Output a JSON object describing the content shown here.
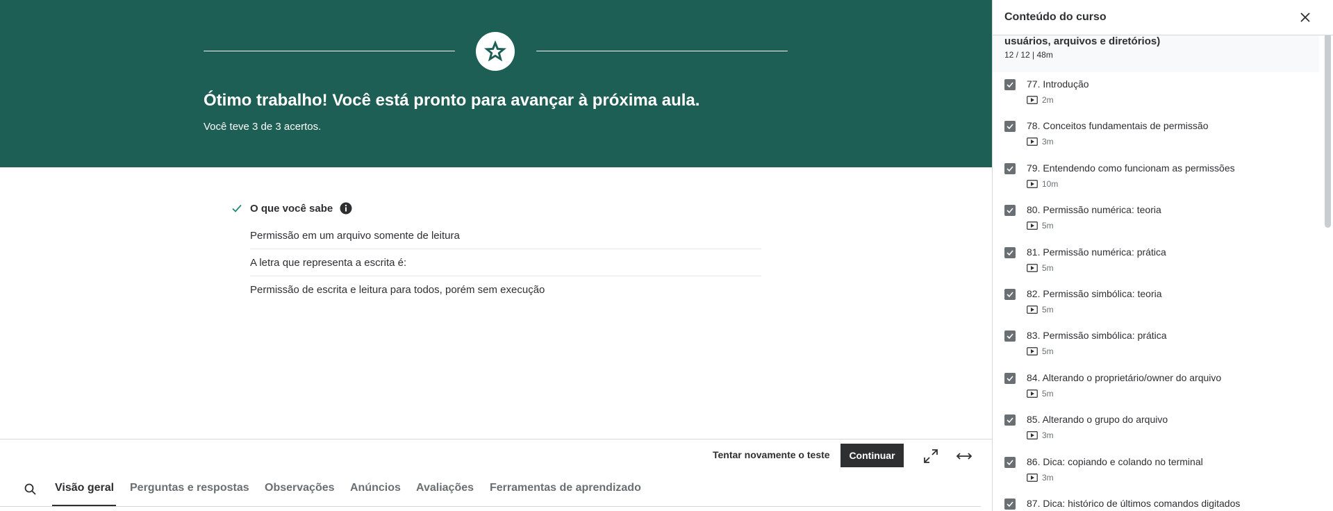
{
  "banner": {
    "title": "Ótimo trabalho! Você está pronto para avançar à próxima aula.",
    "subtitle": "Você teve 3 de 3 acertos.",
    "icon": "star-icon",
    "color": "#1e5f55"
  },
  "known": {
    "label": "O que você sabe",
    "items": [
      "Permissão em um arquivo somente de leitura",
      "A letra que representa a escrita é:",
      "Permissão de escrita e leitura para todos, porém sem execução"
    ]
  },
  "actions": {
    "retry_label": "Tentar novamente o teste",
    "continue_label": "Continuar"
  },
  "tabs": [
    {
      "label": "Visão geral",
      "active": true
    },
    {
      "label": "Perguntas e respostas",
      "active": false
    },
    {
      "label": "Observações",
      "active": false
    },
    {
      "label": "Anúncios",
      "active": false
    },
    {
      "label": "Avaliações",
      "active": false
    },
    {
      "label": "Ferramentas de aprendizado",
      "active": false
    }
  ],
  "sidebar": {
    "title": "Conteúdo do curso",
    "section": {
      "title": "usuários, arquivos e diretórios)",
      "meta": "12 / 12 | 48m"
    },
    "lessons": [
      {
        "title": "77. Introdução",
        "duration": "2m",
        "completed": true
      },
      {
        "title": "78. Conceitos fundamentais de permissão",
        "duration": "3m",
        "completed": true
      },
      {
        "title": "79. Entendendo como funcionam as permissões",
        "duration": "10m",
        "completed": true
      },
      {
        "title": "80. Permissão numérica: teoria",
        "duration": "5m",
        "completed": true
      },
      {
        "title": "81. Permissão numérica: prática",
        "duration": "5m",
        "completed": true
      },
      {
        "title": "82. Permissão simbólica: teoria",
        "duration": "5m",
        "completed": true
      },
      {
        "title": "83. Permissão simbólica: prática",
        "duration": "5m",
        "completed": true
      },
      {
        "title": "84. Alterando o proprietário/owner do arquivo",
        "duration": "5m",
        "completed": true
      },
      {
        "title": "85. Alterando o grupo do arquivo",
        "duration": "3m",
        "completed": true
      },
      {
        "title": "86. Dica: copiando e colando no terminal",
        "duration": "3m",
        "completed": true
      },
      {
        "title": "87. Dica: histórico de últimos comandos digitados",
        "duration": "",
        "completed": true
      }
    ]
  }
}
